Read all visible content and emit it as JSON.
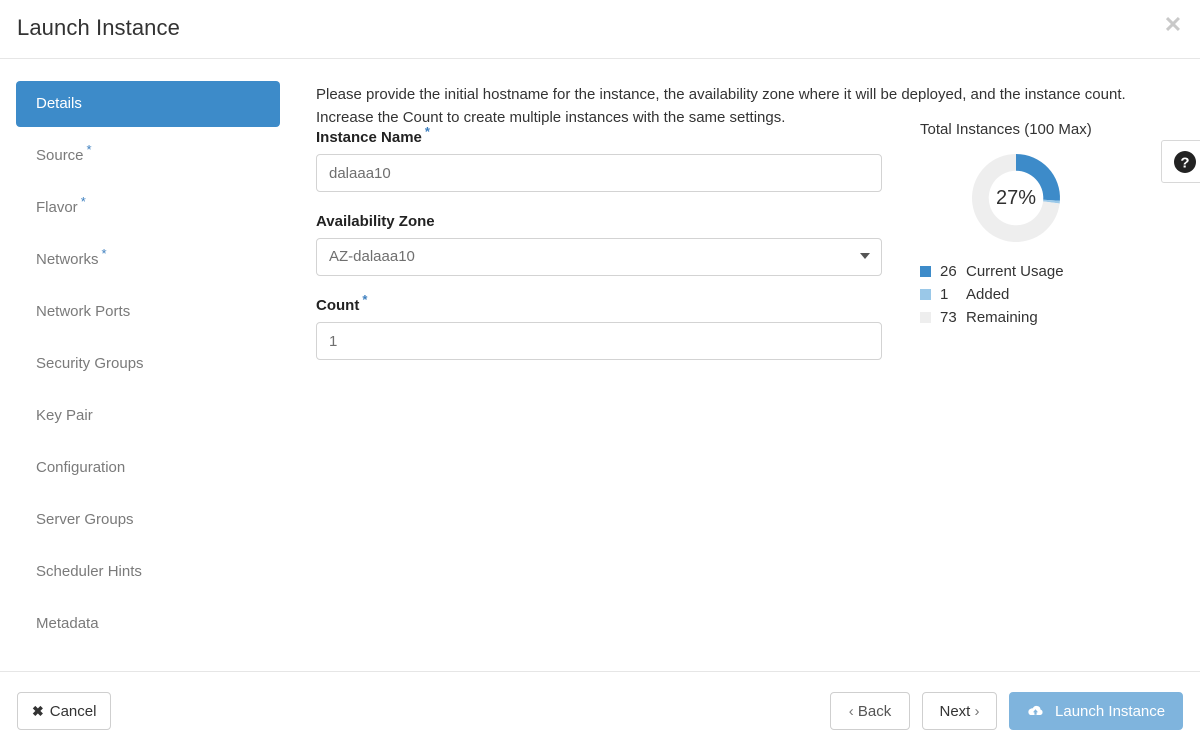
{
  "header": {
    "title": "Launch Instance",
    "close_label": "✕"
  },
  "sidebar": {
    "items": [
      {
        "label": "Details",
        "required": false,
        "active": true
      },
      {
        "label": "Source",
        "required": true,
        "active": false
      },
      {
        "label": "Flavor",
        "required": true,
        "active": false
      },
      {
        "label": "Networks",
        "required": true,
        "active": false
      },
      {
        "label": "Network Ports",
        "required": false,
        "active": false
      },
      {
        "label": "Security Groups",
        "required": false,
        "active": false
      },
      {
        "label": "Key Pair",
        "required": false,
        "active": false
      },
      {
        "label": "Configuration",
        "required": false,
        "active": false
      },
      {
        "label": "Server Groups",
        "required": false,
        "active": false
      },
      {
        "label": "Scheduler Hints",
        "required": false,
        "active": false
      },
      {
        "label": "Metadata",
        "required": false,
        "active": false
      }
    ],
    "required_marker": "*"
  },
  "main": {
    "intro": "Please provide the initial hostname for the instance, the availability zone where it will be deployed, and the instance count. Increase the Count to create multiple instances with the same settings.",
    "fields": {
      "instance_name": {
        "label": "Instance Name",
        "required_marker": "*",
        "value": "dalaaa10",
        "placeholder": "dalaaa10"
      },
      "availability_zone": {
        "label": "Availability Zone",
        "value": "AZ-dalaaa10",
        "options": [
          "AZ-dalaaa10"
        ]
      },
      "count": {
        "label": "Count",
        "required_marker": "*",
        "value": "1",
        "placeholder": "1"
      }
    }
  },
  "quota": {
    "title": "Total Instances (100 Max)",
    "center_label": "27%"
  },
  "help": {
    "icon": "question-mark-circle-icon"
  },
  "footer": {
    "cancel": {
      "label": "Cancel",
      "icon": "x-icon"
    },
    "back": {
      "label": "Back",
      "icon": "chevron-left-icon"
    },
    "next": {
      "label": "Next",
      "icon": "chevron-right-icon"
    },
    "launch": {
      "label": "Launch Instance",
      "icon": "cloud-upload-icon"
    }
  },
  "colors": {
    "accent_blue": "#3d8bc9",
    "current_usage": "#3d8bc9",
    "added": "#9ac8e8",
    "remaining": "#eeeeee",
    "launch_button": "#7fb4dd"
  },
  "chart_data": {
    "type": "pie",
    "title": "Total Instances (100 Max)",
    "center_label": "27%",
    "max": 100,
    "categories": [
      "Current Usage",
      "Added",
      "Remaining"
    ],
    "values": [
      26,
      1,
      73
    ],
    "colors": [
      "#3d8bc9",
      "#9ac8e8",
      "#eeeeee"
    ],
    "legend": [
      {
        "value": "26",
        "label": "Current Usage",
        "color": "#3d8bc9"
      },
      {
        "value": "1",
        "label": "Added",
        "color": "#9ac8e8"
      },
      {
        "value": "73",
        "label": "Remaining",
        "color": "#eeeeee"
      }
    ],
    "legend_position": "below",
    "start_angle_deg": 0,
    "donut": true,
    "inner_radius_ratio": 0.62
  }
}
